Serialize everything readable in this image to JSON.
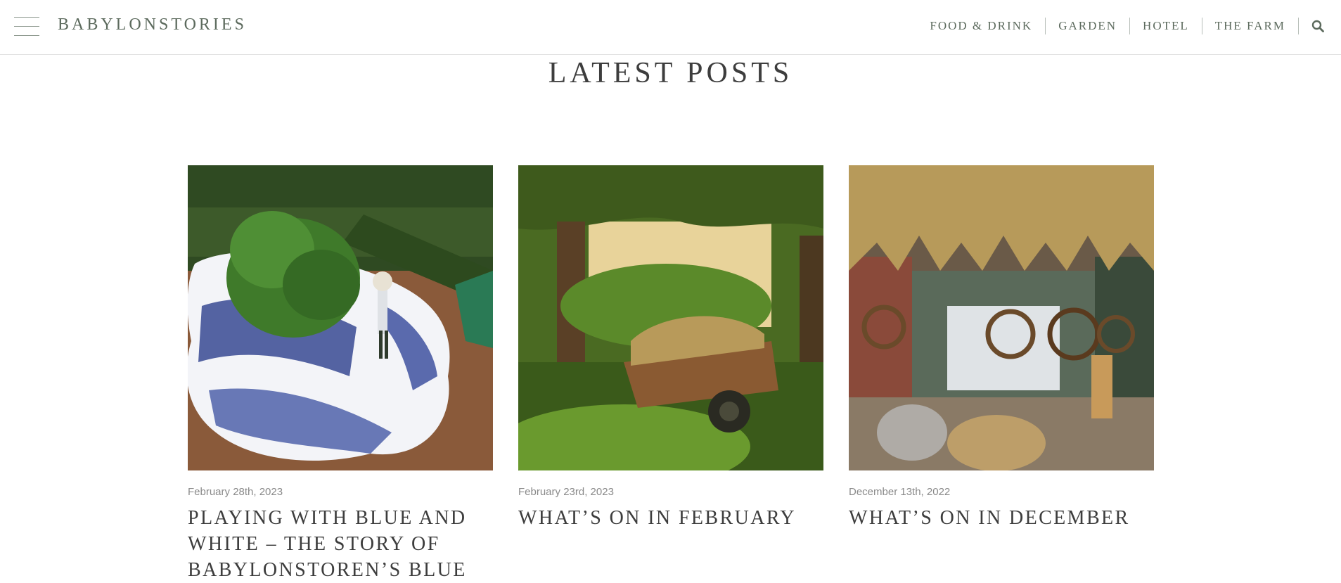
{
  "header": {
    "logo": "BABYLONSTORIES",
    "nav": [
      "FOOD & DRINK",
      "GARDEN",
      "HOTEL",
      "THE FARM"
    ],
    "menu_icon": "hamburger-menu-icon",
    "search_icon": "search-icon"
  },
  "section": {
    "title": "LATEST POSTS"
  },
  "posts": [
    {
      "date": "February 28th, 2023",
      "title": "PLAYING WITH BLUE AND WHITE – THE STORY OF BABYLONSTOREN’S BLUE",
      "image": "garden-blue-white-rug-photo"
    },
    {
      "date": "February 23rd, 2023",
      "title": "WHAT’S ON IN FEBRUARY",
      "image": "garden-wooden-cart-photo"
    },
    {
      "date": "December 13th, 2022",
      "title": "WHAT’S ON IN DECEMBER",
      "image": "dried-flowers-wreaths-shop-photo"
    }
  ],
  "colors": {
    "brand": "#5c6a5d",
    "text": "#3d3d3d",
    "date": "#8a8a8a",
    "divider": "#e3e3e3"
  }
}
